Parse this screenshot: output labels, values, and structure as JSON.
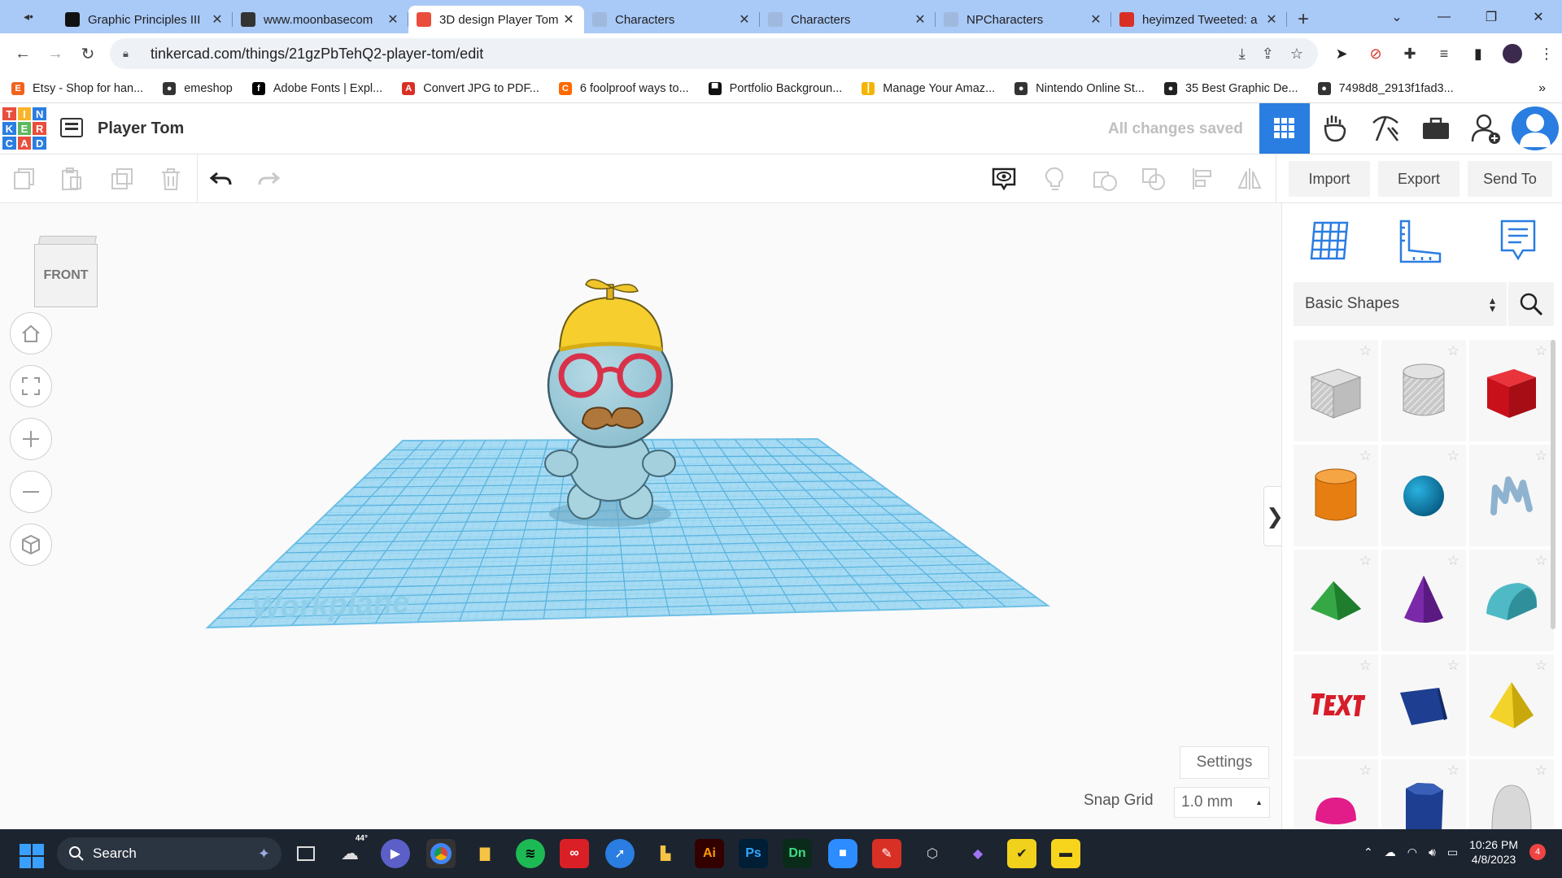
{
  "browser": {
    "tabs": [
      {
        "title": "Graphic Principles III",
        "favicon_color": "#111111",
        "active": false
      },
      {
        "title": "www.moonbasecom",
        "favicon_color": "#333333",
        "active": false
      },
      {
        "title": "3D design Player Tom",
        "favicon_color": "#e94e3d",
        "active": true
      },
      {
        "title": "Characters",
        "favicon_color": "#9fb8dd",
        "active": false
      },
      {
        "title": "Characters",
        "favicon_color": "#9fb8dd",
        "active": false
      },
      {
        "title": "NPCharacters",
        "favicon_color": "#9fb8dd",
        "active": false
      },
      {
        "title": "heyimzed Tweeted: a",
        "favicon_color": "#d93025",
        "active": false
      }
    ],
    "url": "tinkercad.com/things/21gzPbTehQ2-player-tom/edit",
    "bookmarks": [
      {
        "label": "Etsy - Shop for han...",
        "icon": "etsy-icon",
        "color": "#f1641e",
        "glyph": "E"
      },
      {
        "label": "emeshop",
        "icon": "globe-icon",
        "color": "#333333",
        "glyph": "●"
      },
      {
        "label": "Adobe Fonts | Expl...",
        "icon": "adobe-fonts-icon",
        "color": "#000000",
        "glyph": "f"
      },
      {
        "label": "Convert JPG to PDF...",
        "icon": "pdf-icon",
        "color": "#d93025",
        "glyph": "A"
      },
      {
        "label": "6 foolproof ways to...",
        "icon": "bookmark-icon",
        "color": "#ff6a00",
        "glyph": "C"
      },
      {
        "label": "Portfolio Backgroun...",
        "icon": "portfolio-icon",
        "color": "#111111",
        "glyph": "▀"
      },
      {
        "label": "Manage Your Amaz...",
        "icon": "amazon-icon",
        "color": "#f4b400",
        "glyph": "┃"
      },
      {
        "label": "Nintendo Online St...",
        "icon": "globe-icon",
        "color": "#333333",
        "glyph": "●"
      },
      {
        "label": "35 Best Graphic De...",
        "icon": "bookmark-icon",
        "color": "#222222",
        "glyph": "●"
      },
      {
        "label": "7498d8_2913f1fad3...",
        "icon": "globe-icon",
        "color": "#333333",
        "glyph": "●"
      }
    ]
  },
  "tinkercad": {
    "logo_letters": [
      "T",
      "I",
      "N",
      "K",
      "E",
      "R",
      "C",
      "A",
      "D"
    ],
    "logo_colors": [
      "#e94e3d",
      "#f8b52a",
      "#2a7de1",
      "#2a7de1",
      "#5cb85c",
      "#e94e3d",
      "#2a7de1",
      "#e94e3d",
      "#2a7de1"
    ],
    "design_title": "Player Tom",
    "save_status": "All changes saved",
    "toolbar": {
      "import_label": "Import",
      "export_label": "Export",
      "send_to_label": "Send To"
    },
    "viewcube_label": "FRONT",
    "workplane_label": "Workplane",
    "settings_label": "Settings",
    "snap_grid_label": "Snap Grid",
    "snap_grid_value": "1.0 mm",
    "shape_category": "Basic Shapes",
    "accent_color": "#2a7de1"
  },
  "taskbar": {
    "search_placeholder": "Search",
    "weather_temp": "44°",
    "time": "10:26 PM",
    "date": "4/8/2023",
    "notification_count": "4",
    "apps": [
      {
        "glyph": "Ai",
        "bg": "#330000",
        "fg": "#ff9a00"
      },
      {
        "glyph": "Ps",
        "bg": "#001e36",
        "fg": "#31a8ff"
      },
      {
        "glyph": "Dn",
        "bg": "#0b2b1a",
        "fg": "#3ddc84"
      }
    ]
  }
}
